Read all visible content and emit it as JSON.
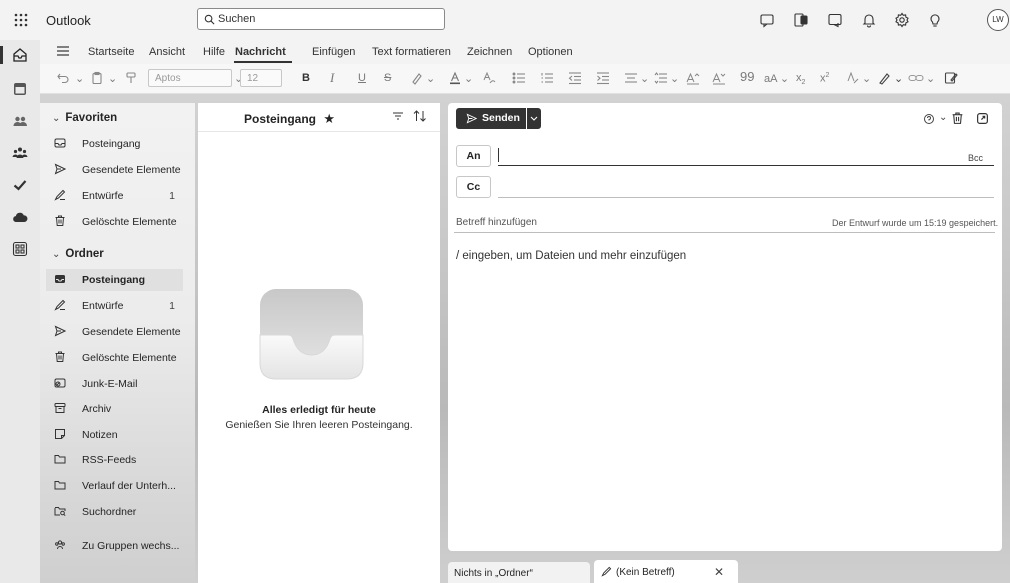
{
  "app": {
    "title": "Outlook",
    "avatar_initials": "LW"
  },
  "search": {
    "placeholder": "Suchen"
  },
  "ribbon": {
    "tabs": [
      "Startseite",
      "Ansicht",
      "Hilfe",
      "Nachricht",
      "Einfügen",
      "Text formatieren",
      "Zeichnen",
      "Optionen"
    ],
    "active_tab": "Nachricht",
    "font_name": "Aptos",
    "font_size": "12"
  },
  "favorites": {
    "title": "Favoriten",
    "items": [
      {
        "label": "Posteingang",
        "count": ""
      },
      {
        "label": "Gesendete Elemente",
        "count": ""
      },
      {
        "label": "Entwürfe",
        "count": "1"
      },
      {
        "label": "Gelöschte Elemente",
        "count": ""
      }
    ]
  },
  "folders": {
    "title": "Ordner",
    "items": [
      {
        "label": "Posteingang",
        "count": ""
      },
      {
        "label": "Entwürfe",
        "count": "1"
      },
      {
        "label": "Gesendete Elemente",
        "count": ""
      },
      {
        "label": "Gelöschte Elemente",
        "count": ""
      },
      {
        "label": "Junk-E-Mail",
        "count": ""
      },
      {
        "label": "Archiv",
        "count": ""
      },
      {
        "label": "Notizen",
        "count": ""
      },
      {
        "label": "RSS-Feeds",
        "count": ""
      },
      {
        "label": "Verlauf der Unterh...",
        "count": ""
      },
      {
        "label": "Suchordner",
        "count": ""
      }
    ],
    "groups_link": "Zu Gruppen wechs..."
  },
  "message_list": {
    "title": "Posteingang",
    "empty_title": "Alles erledigt für heute",
    "empty_subtitle": "Genießen Sie Ihren leeren Posteingang."
  },
  "compose": {
    "send_label": "Senden",
    "to_label": "An",
    "cc_label": "Cc",
    "bcc_label": "Bcc",
    "subject_placeholder": "Betreff hinzufügen",
    "draft_status": "Der Entwurf wurde um 15:19 gespeichert.",
    "body_placeholder": "/ eingeben, um Dateien und mehr einzufügen"
  },
  "bottom_tabs": {
    "tab1": "Nichts in „Ordner“",
    "tab2": "(Kein Betreff)"
  }
}
